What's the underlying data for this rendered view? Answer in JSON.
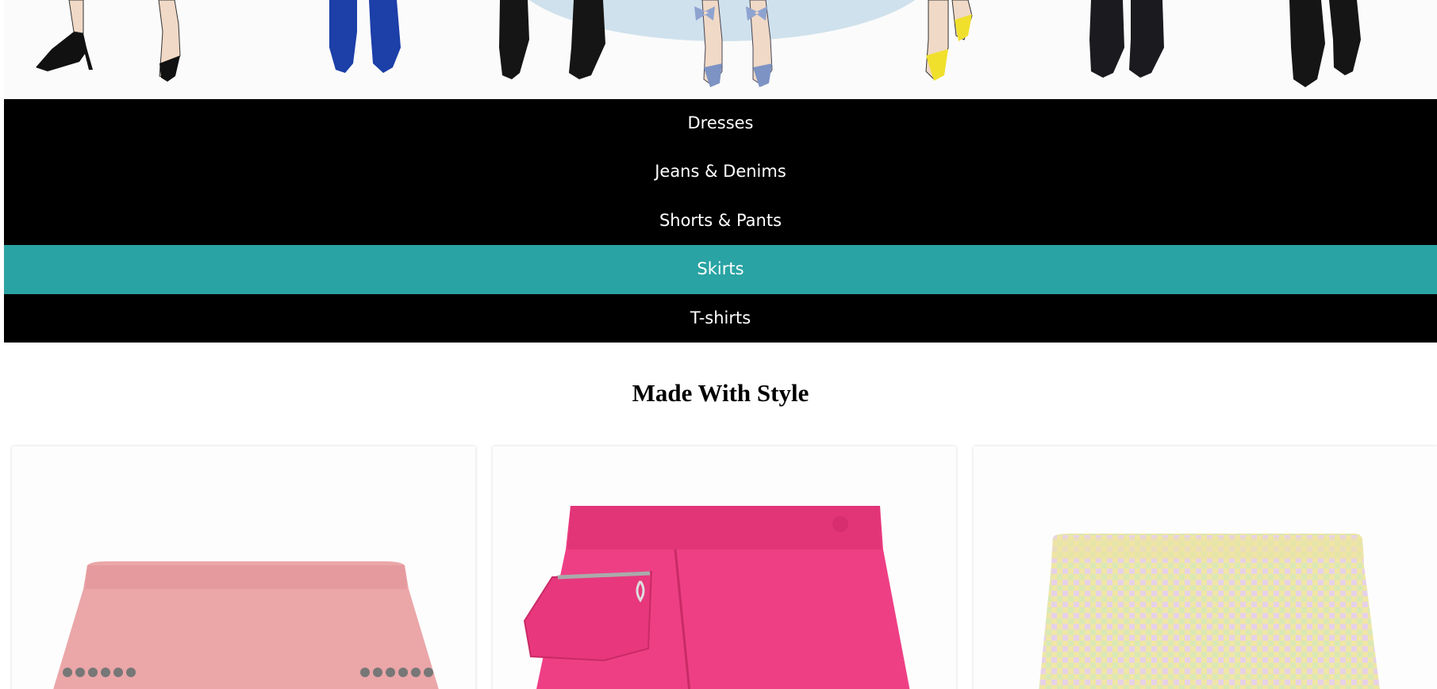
{
  "nav": {
    "items": [
      {
        "label": "Dresses",
        "active": false
      },
      {
        "label": "Jeans & Denims",
        "active": false
      },
      {
        "label": "Shorts & Pants",
        "active": false
      },
      {
        "label": "Skirts",
        "active": true
      },
      {
        "label": "T-shirts",
        "active": false
      }
    ],
    "active_color": "#29a3a3",
    "bar_color": "#000000"
  },
  "section": {
    "heading": "Made With Style"
  },
  "products": [
    {
      "name": "pink-tweed-skirt",
      "color": "#eba6a8"
    },
    {
      "name": "pink-wrap-cargo-skirt",
      "color": "#ee3f85"
    },
    {
      "name": "houndstooth-pastel-skirt",
      "color": "#efe6a7"
    }
  ],
  "hero": {
    "icon": "shoe-illustrations-banner"
  }
}
